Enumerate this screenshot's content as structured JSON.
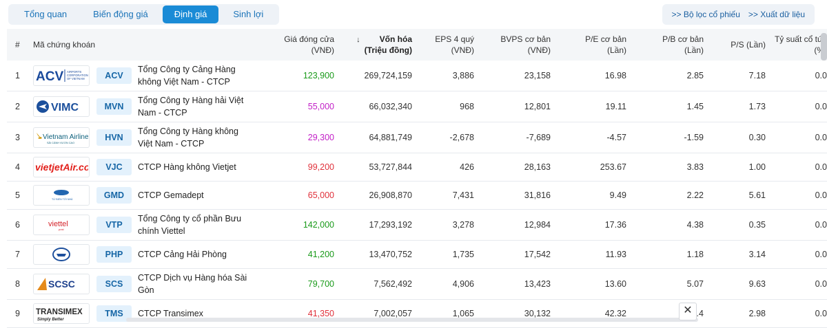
{
  "tabs": [
    {
      "label": "Tổng quan",
      "active": false
    },
    {
      "label": "Biến động giá",
      "active": false
    },
    {
      "label": "Định giá",
      "active": true
    },
    {
      "label": "Sinh lợi",
      "active": false
    }
  ],
  "actions": {
    "filter": ">> Bộ lọc cổ phiếu",
    "export": ">> Xuất dữ liệu"
  },
  "columns": {
    "idx": "#",
    "symbol": "Mã chứng khoán",
    "price": [
      "Giá đóng cửa",
      "(VNĐ)"
    ],
    "cap": [
      "Vốn hóa",
      "(Triệu đồng)"
    ],
    "eps": [
      "EPS 4 quý",
      "(VNĐ)"
    ],
    "bvps": [
      "BVPS cơ bản",
      "(VNĐ)"
    ],
    "pe": [
      "P/E cơ bản",
      "(Lần)"
    ],
    "pb": [
      "P/B cơ bản",
      "(Lần)"
    ],
    "ps": "P/S (Lần)",
    "ts": [
      "Tỷ suất cổ tức",
      "(%)"
    ]
  },
  "colors": {
    "up": "#1a9a1a",
    "down": "#e0303a",
    "ceiling": "#c21fc7",
    "accent": "#1a8bd6"
  },
  "rows": [
    {
      "idx": "1",
      "logo": "ACV",
      "ticker": "ACV",
      "name": "Tổng Công ty Cảng Hàng không Việt Nam - CTCP",
      "price": "123,900",
      "price_color": "#1a9a1a",
      "cap": "269,724,159",
      "eps": "3,886",
      "bvps": "23,158",
      "pe": "16.98",
      "pb": "2.85",
      "ps": "7.18",
      "ts": "0.0"
    },
    {
      "idx": "2",
      "logo": "VIMC",
      "ticker": "MVN",
      "name": "Tổng Công ty Hàng hải Việt Nam - CTCP",
      "price": "55,000",
      "price_color": "#c21fc7",
      "cap": "66,032,340",
      "eps": "968",
      "bvps": "12,801",
      "pe": "19.11",
      "pb": "1.45",
      "ps": "1.73",
      "ts": "0.0"
    },
    {
      "idx": "3",
      "logo": "Vietnam Airlines",
      "ticker": "HVN",
      "name": "Tổng Công ty Hàng không Việt Nam - CTCP",
      "price": "29,300",
      "price_color": "#c21fc7",
      "cap": "64,881,749",
      "eps": "-2,678",
      "bvps": "-7,689",
      "pe": "-4.57",
      "pb": "-1.59",
      "ps": "0.30",
      "ts": "0.0"
    },
    {
      "idx": "4",
      "logo": "vietjetAir.com",
      "ticker": "VJC",
      "name": "CTCP Hàng không Vietjet",
      "price": "99,200",
      "price_color": "#e0303a",
      "cap": "53,727,844",
      "eps": "426",
      "bvps": "28,163",
      "pe": "253.67",
      "pb": "3.83",
      "ps": "1.00",
      "ts": "0.0"
    },
    {
      "idx": "5",
      "logo": "GMD",
      "ticker": "GMD",
      "name": "CTCP Gemadept",
      "price": "65,000",
      "price_color": "#e0303a",
      "cap": "26,908,870",
      "eps": "7,431",
      "bvps": "31,816",
      "pe": "9.49",
      "pb": "2.22",
      "ps": "5.61",
      "ts": "0.0"
    },
    {
      "idx": "6",
      "logo": "viettel",
      "ticker": "VTP",
      "name": "Tổng Công ty cổ phần Bưu chính Viettel",
      "price": "142,000",
      "price_color": "#1a9a1a",
      "cap": "17,293,192",
      "eps": "3,278",
      "bvps": "12,984",
      "pe": "17.36",
      "pb": "4.38",
      "ps": "0.35",
      "ts": "0.0"
    },
    {
      "idx": "7",
      "logo": "PHP",
      "ticker": "PHP",
      "name": "CTCP Cảng Hải Phòng",
      "price": "41,200",
      "price_color": "#1a9a1a",
      "cap": "13,470,752",
      "eps": "1,735",
      "bvps": "17,542",
      "pe": "11.93",
      "pb": "1.18",
      "ps": "3.14",
      "ts": "0.0"
    },
    {
      "idx": "8",
      "logo": "SCSC",
      "ticker": "SCS",
      "name": "CTCP Dịch vụ Hàng hóa Sài Gòn",
      "price": "79,700",
      "price_color": "#1a9a1a",
      "cap": "7,562,492",
      "eps": "4,906",
      "bvps": "13,423",
      "pe": "13.60",
      "pb": "5.07",
      "ps": "9.63",
      "ts": "0.0"
    },
    {
      "idx": "9",
      "logo": "TRANSIMEX",
      "ticker": "TMS",
      "name": "CTCP Transimex",
      "price": "41,350",
      "price_color": "#e0303a",
      "cap": "7,002,057",
      "eps": "1,065",
      "bvps": "30,132",
      "pe": "42.32",
      "pb": "1.4",
      "ps": "2.98",
      "ts": "0.0"
    }
  ]
}
